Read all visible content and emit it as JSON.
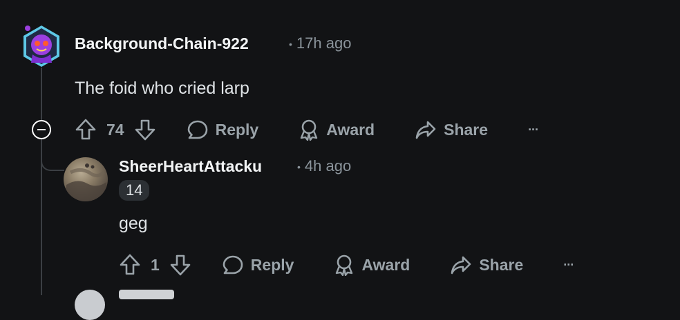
{
  "comment": {
    "author": "Background-Chain-922",
    "time": "17h ago",
    "body": "The foid who cried larp",
    "votes": "74",
    "reply_label": "Reply",
    "award_label": "Award",
    "share_label": "Share",
    "more_label": "···"
  },
  "reply": {
    "author": "SheerHeartAttacku",
    "time": "4h ago",
    "flair": "14",
    "body": "geg",
    "votes": "1",
    "reply_label": "Reply",
    "award_label": "Award",
    "share_label": "Share",
    "more_label": "···"
  },
  "colors": {
    "background": "#121315",
    "text": "#f2f4f5",
    "muted": "#8b949b",
    "thread_line": "#3b3f43"
  }
}
